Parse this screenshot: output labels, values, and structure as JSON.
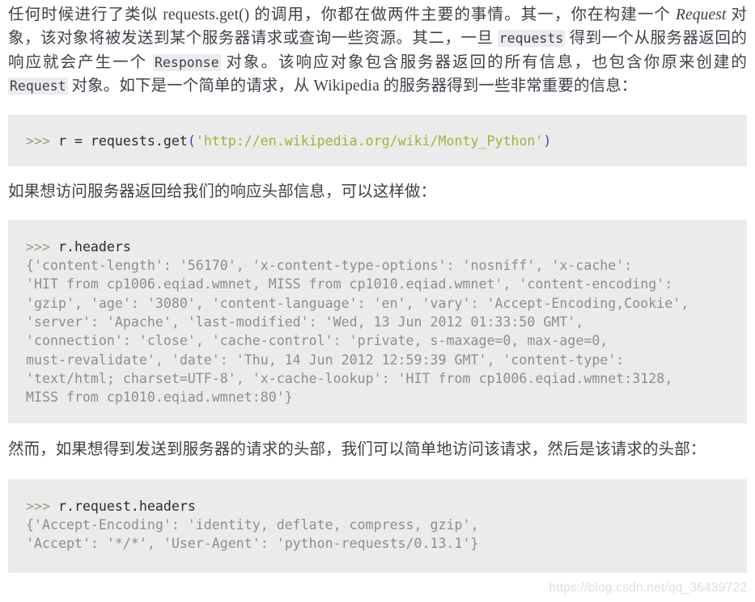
{
  "document": {
    "paragraphs": {
      "intro": {
        "seg1": "任何时候进行了类似 requests.get() 的调用，你都在做两件主要的事情。其一，你在构建一个 ",
        "em_request": "Request",
        "seg2": " 对象，该对象将被发送到某个服务器请求或查询一些资源。其二，一旦 ",
        "code_requests": "requests",
        "seg3": " 得到一个从服务器返回的响应就会产生一个 ",
        "code_response": "Response",
        "seg4": " 对象。该响应对象包含服务器返回的所有信息，也包含你原来创建的 ",
        "code_request": "Request",
        "seg5": " 对象。如下是一个简单的请求，从 Wikipedia 的服务器得到一些非常重要的信息："
      },
      "mid1": "如果想访问服务器返回给我们的响应头部信息，可以这样做：",
      "mid2": "然而，如果想得到发送到服务器的请求的头部，我们可以简单地访问该请求，然后是该请求的头部："
    },
    "code_blocks": {
      "block1": {
        "prompt": ">>> ",
        "code_a": "r = requests.get",
        "paren_open": "(",
        "string": "'http://en.wikipedia.org/wiki/Monty_Python'",
        "paren_close": ")"
      },
      "block2": {
        "prompt": ">>> ",
        "command": "r.headers",
        "output": "{'content-length': '56170', 'x-content-type-options': 'nosniff', 'x-cache':\n'HIT from cp1006.eqiad.wmnet, MISS from cp1010.eqiad.wmnet', 'content-encoding':\n'gzip', 'age': '3080', 'content-language': 'en', 'vary': 'Accept-Encoding,Cookie',\n'server': 'Apache', 'last-modified': 'Wed, 13 Jun 2012 01:33:50 GMT',\n'connection': 'close', 'cache-control': 'private, s-maxage=0, max-age=0,\nmust-revalidate', 'date': 'Thu, 14 Jun 2012 12:59:39 GMT', 'content-type':\n'text/html; charset=UTF-8', 'x-cache-lookup': 'HIT from cp1006.eqiad.wmnet:3128,\nMISS from cp1010.eqiad.wmnet:80'}"
      },
      "block3": {
        "prompt": ">>> ",
        "command": "r.request.headers",
        "output": "{'Accept-Encoding': 'identity, deflate, compress, gzip',\n'Accept': '*/*', 'User-Agent': 'python-requests/0.13.1'}"
      }
    },
    "watermark": "https://blog.csdn.net/qq_36439722",
    "colors": {
      "code_background": "#ebebeb",
      "inline_code_background": "#eaecef",
      "prose_text": "#3f3f4a",
      "string_literal": "#a6b13a",
      "prompt": "#9a9a84",
      "output_text": "#8e8e8e",
      "watermark": "#dedede"
    }
  }
}
